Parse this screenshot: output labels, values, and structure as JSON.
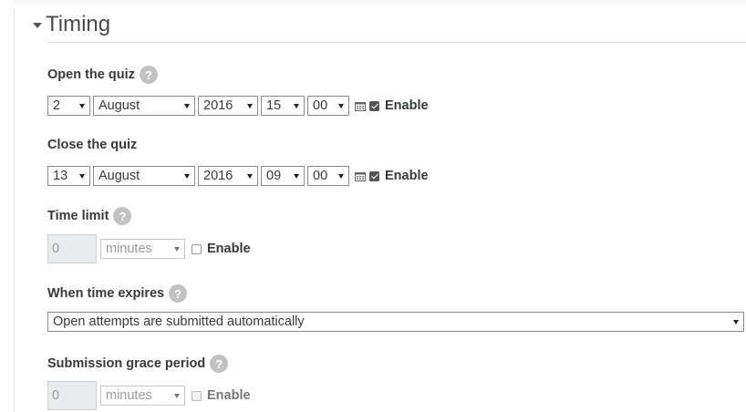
{
  "section": {
    "title": "Timing"
  },
  "open_quiz": {
    "label": "Open the quiz",
    "help": "?",
    "day": "2",
    "month": "August",
    "year": "2016",
    "hour": "15",
    "minute": "00",
    "enable_label": "Enable",
    "enabled": true
  },
  "close_quiz": {
    "label": "Close the quiz",
    "help": "?",
    "day": "13",
    "month": "August",
    "year": "2016",
    "hour": "09",
    "minute": "00",
    "enable_label": "Enable",
    "enabled": true
  },
  "time_limit": {
    "label": "Time limit",
    "help": "?",
    "value": "0",
    "unit": "minutes",
    "enable_label": "Enable",
    "enabled": false
  },
  "time_expires": {
    "label": "When time expires",
    "help": "?",
    "selected": "Open attempts are submitted automatically"
  },
  "grace_period": {
    "label": "Submission grace period",
    "help": "?",
    "value": "0",
    "unit": "minutes",
    "enable_label": "Enable",
    "enabled": false
  },
  "icons": {
    "calendar": "calendar-icon",
    "help": "help-icon",
    "collapse": "caret-down-icon"
  },
  "colors": {
    "help_bg": "#c2c2c2",
    "disabled_bg": "#e9ecef",
    "text": "#373a3c"
  }
}
